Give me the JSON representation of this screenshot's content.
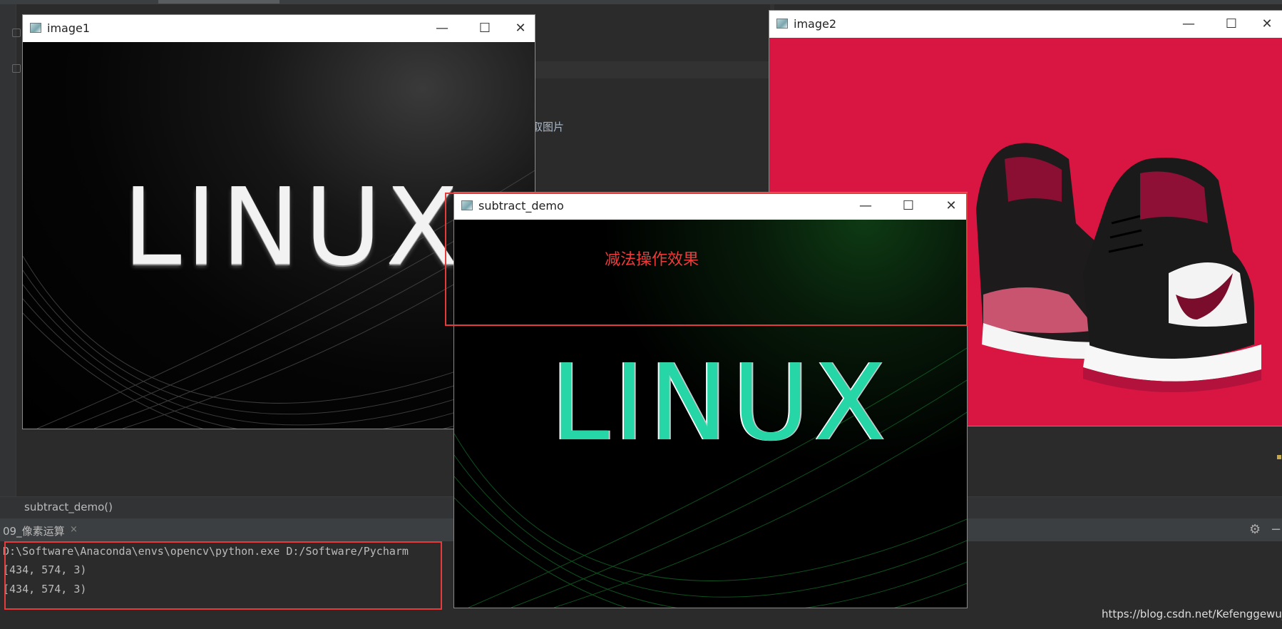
{
  "editor": {
    "partial_text": "取图片",
    "breadcrumb": "subtract_demo()"
  },
  "run_panel": {
    "tab_label": "09_像素运算",
    "close_glyph": "×",
    "gear_glyph": "⚙",
    "minimize_glyph": "−",
    "console_lines": [
      "D:\\Software\\Anaconda\\envs\\opencv\\python.exe D:/Software/Pycharm",
      "[434, 574, 3)",
      "[434, 574, 3)"
    ]
  },
  "windows": {
    "image1": {
      "title": "image1",
      "content_text": "LINUX"
    },
    "image2": {
      "title": "image2"
    },
    "subtract_demo": {
      "title": "subtract_demo",
      "content_text": "LINUX"
    }
  },
  "window_buttons": {
    "minimize": "—",
    "maximize": "☐",
    "close": "✕"
  },
  "annotation": {
    "caption": "减法操作效果",
    "color": "#e53b3b"
  },
  "watermark": "https://blog.csdn.net/Kefenggewu_",
  "colors": {
    "ide_bg": "#2b2b2b",
    "shoe_bg": "#d91542",
    "teal": "#27d6a6"
  }
}
